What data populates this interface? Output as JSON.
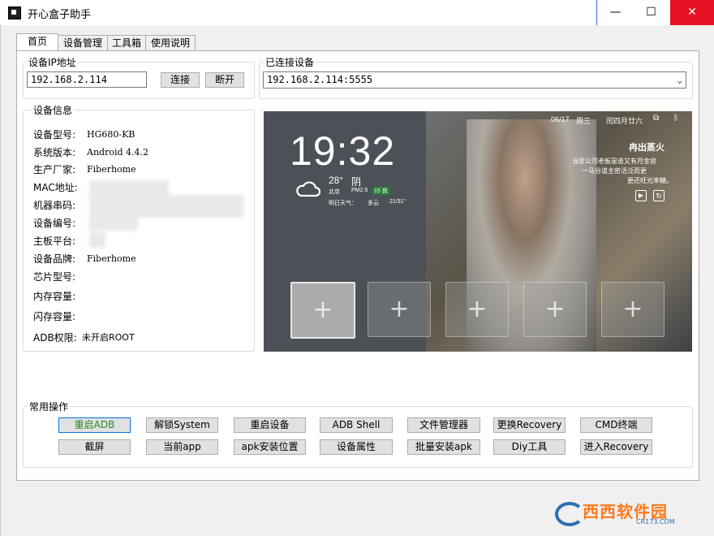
{
  "window": {
    "title": "开心盒子助手",
    "controls": {
      "minimize": "—",
      "maximize": "☐",
      "close": "✕"
    }
  },
  "tabs": [
    "首页",
    "设备管理",
    "工具箱",
    "使用说明"
  ],
  "ip_group": {
    "title": "设备IP地址",
    "ip_value": "192.168.2.114",
    "connect_label": "连接",
    "disconnect_label": "断开"
  },
  "connected_group": {
    "title": "已连接设备",
    "selected": "192.168.2.114:5555"
  },
  "device_info": {
    "title": "设备信息",
    "rows": [
      {
        "label": "设备型号:",
        "value": "HG680-KB"
      },
      {
        "label": "系统版本:",
        "value": "Android 4.4.2"
      },
      {
        "label": "生产厂家:",
        "value": "Fiberhome"
      },
      {
        "label": "MAC地址:",
        "value": ""
      },
      {
        "label": "机器串码:",
        "value": ""
      },
      {
        "label": "设备编号:",
        "value": ""
      },
      {
        "label": "主板平台:",
        "value": ""
      },
      {
        "label": "设备品牌:",
        "value": "Fiberhome"
      },
      {
        "label": "芯片型号:",
        "value": ""
      },
      {
        "label": "内存容量:",
        "value": ""
      },
      {
        "label": "闪存容量:",
        "value": ""
      },
      {
        "label": "ADB权限:",
        "value": "未开启ROOT"
      }
    ]
  },
  "preview": {
    "date": "06/17",
    "weekday": "周三",
    "lunar": "闰四月廿六",
    "time": "19:32",
    "temp": "28°",
    "weather": "阴",
    "city": "北京",
    "pm_label": "PM2.5",
    "pm_value": "15 良",
    "tomorrow_label": "明日天气：",
    "tomorrow_weather": "多云",
    "tomorrow_temp": "21/31°",
    "promo_title": "冉出蒸火",
    "promo_lines": [
      "当匪公司老板是谁又有月金容",
      "一马谷道主密活泛而更",
      "更还旺光率糖。"
    ]
  },
  "operations": {
    "title": "常用操作",
    "row1": [
      "重启ADB",
      "解锁System",
      "重启设备",
      "ADB Shell",
      "文件管理器",
      "更换Recovery",
      "CMD终端"
    ],
    "row2": [
      "截屏",
      "当前app",
      "apk安装位置",
      "设备属性",
      "批量安装apk",
      "Diy工具",
      "进入Recovery"
    ]
  },
  "watermark": {
    "text": "西西软件园",
    "sub": "CR173.COM"
  }
}
